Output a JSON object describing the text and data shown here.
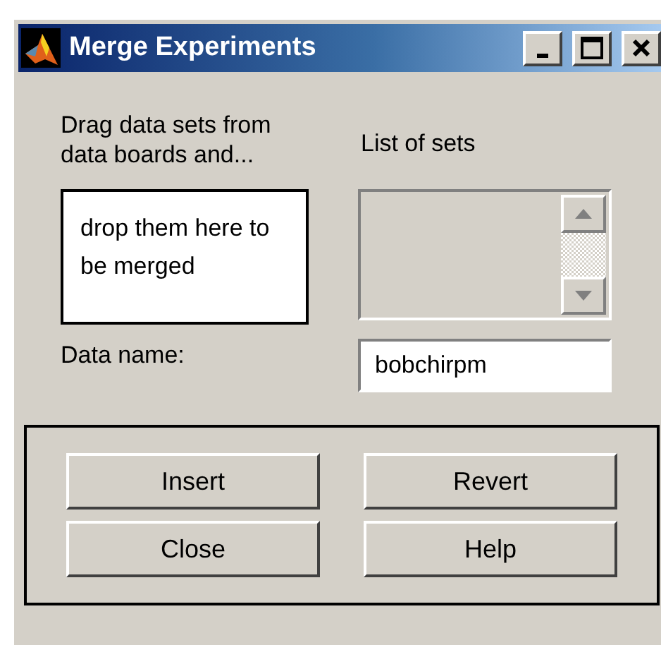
{
  "window": {
    "title": "Merge Experiments"
  },
  "instructions": "Drag data sets from data boards and...",
  "drop_zone": {
    "text": "drop them here to be merged"
  },
  "list_of_sets": {
    "label": "List of sets"
  },
  "data_name": {
    "label": "Data name:",
    "value": "bobchirpm"
  },
  "buttons": [
    "Insert",
    "Revert",
    "Close",
    "Help"
  ]
}
